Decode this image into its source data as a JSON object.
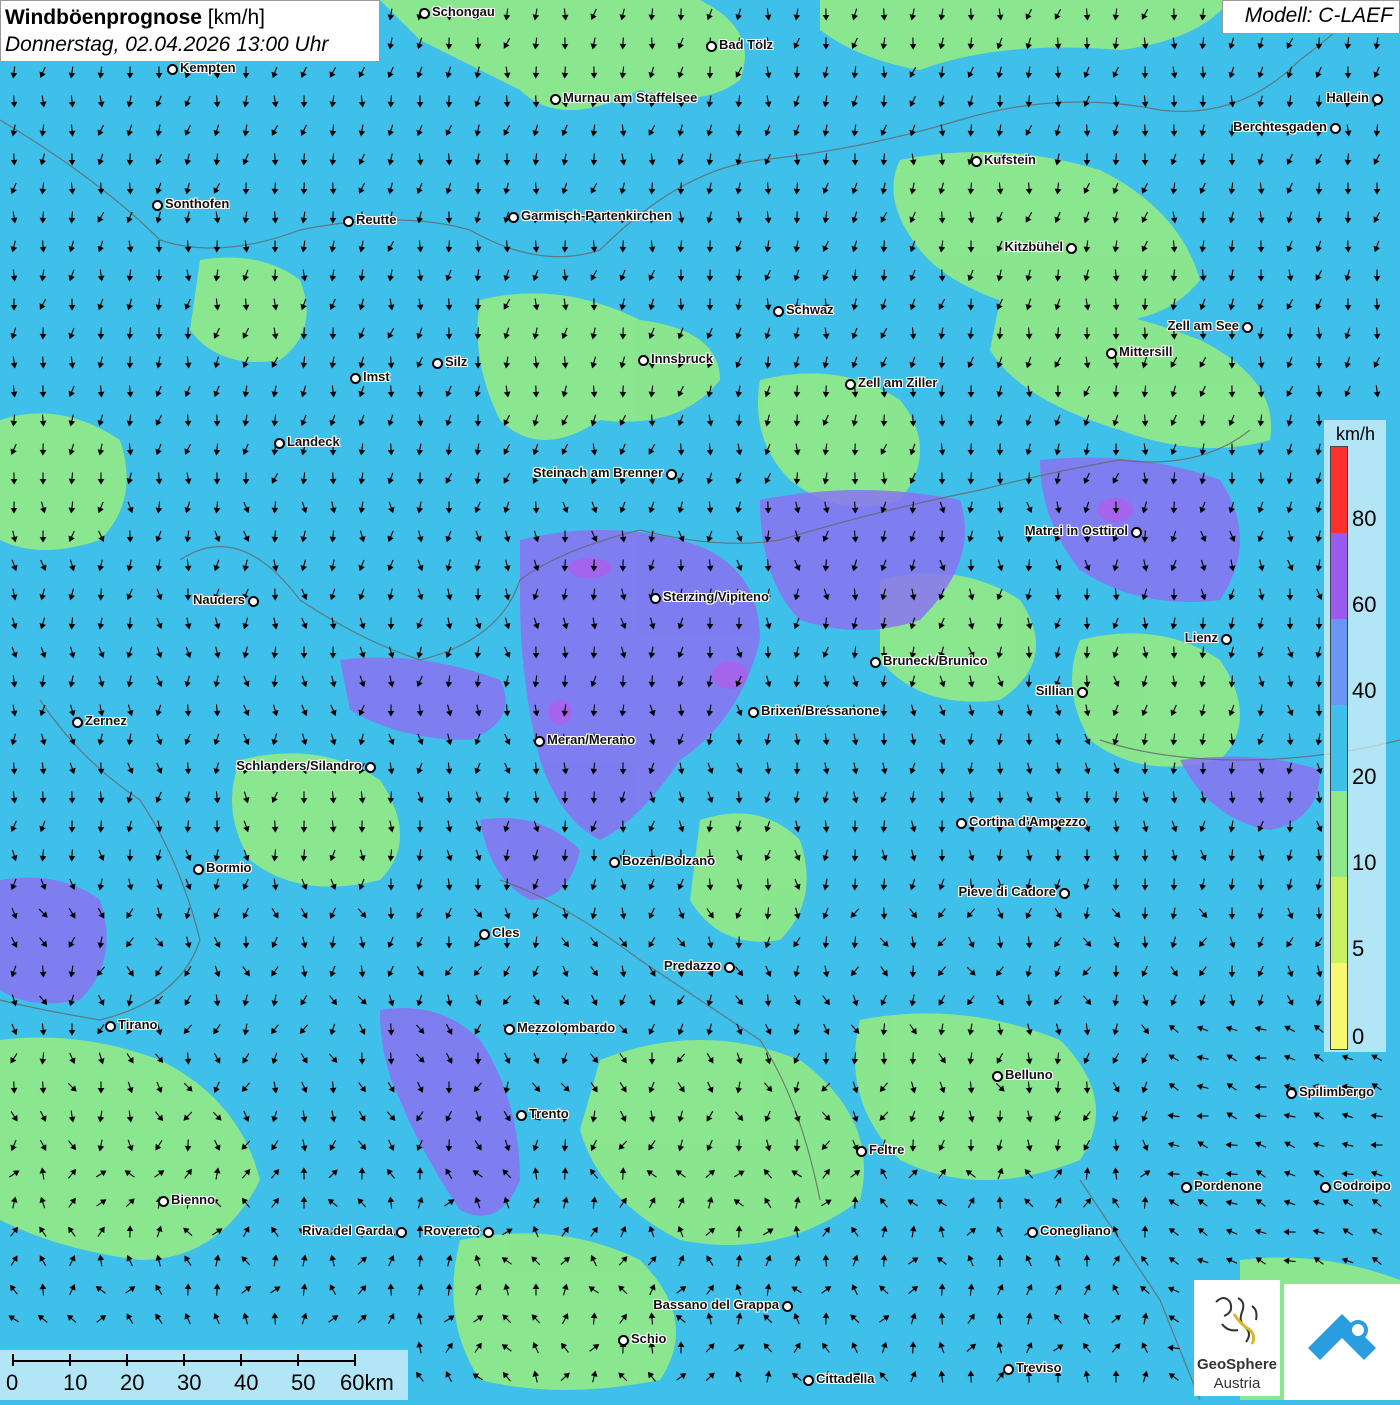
{
  "title": {
    "bold": "Windböenprognose",
    "unit": " [km/h]",
    "date": "Donnerstag, 02.04.2026 13:00 Uhr"
  },
  "model": "Modell: C-LAEF",
  "legend": {
    "unit": "km/h",
    "ticks": [
      "80",
      "60",
      "40",
      "20",
      "10",
      "5",
      "0"
    ],
    "colors": [
      "#ff3030",
      "#9a5cf0",
      "#6a96f6",
      "#3fc0ea",
      "#8ee88a",
      "#c8f060",
      "#f8f870"
    ]
  },
  "scalebar": {
    "labels": [
      "0",
      "10",
      "20",
      "30",
      "40",
      "50",
      "60km"
    ]
  },
  "logo": {
    "line1": "GeoSphere",
    "line2": "Austria"
  },
  "colors": {
    "background": "#3fc0ea",
    "light_green": "#8ee88a",
    "purple": "#9a5cf0",
    "blue": "#6a96f6"
  },
  "cities": [
    {
      "name": "Schongau",
      "side": "right"
    },
    {
      "name": "Bad Tölz",
      "side": "right"
    },
    {
      "name": "Kempten",
      "side": "right"
    },
    {
      "name": "Murnau am Staffelsee",
      "side": "right"
    },
    {
      "name": "Hallein",
      "side": "left"
    },
    {
      "name": "Berchtesgaden",
      "side": "left"
    },
    {
      "name": "Kufstein",
      "side": "right"
    },
    {
      "name": "Sonthofen",
      "side": "right"
    },
    {
      "name": "Reutte",
      "side": "right"
    },
    {
      "name": "Garmisch-Partenkirchen",
      "side": "right"
    },
    {
      "name": "Kitzbühel",
      "side": "left"
    },
    {
      "name": "Schwaz",
      "side": "right"
    },
    {
      "name": "Zell am See",
      "side": "left"
    },
    {
      "name": "Innsbruck",
      "side": "right"
    },
    {
      "name": "Mittersill",
      "side": "right"
    },
    {
      "name": "Imst",
      "side": "right"
    },
    {
      "name": "Silz",
      "side": "right"
    },
    {
      "name": "Zell am Ziller",
      "side": "right"
    },
    {
      "name": "Landeck",
      "side": "right"
    },
    {
      "name": "Steinach am Brenner",
      "side": "left"
    },
    {
      "name": "Matrei in Osttirol",
      "side": "left"
    },
    {
      "name": "Nauders",
      "side": "left"
    },
    {
      "name": "Sterzing/Vipiteno",
      "side": "right"
    },
    {
      "name": "Lienz",
      "side": "left"
    },
    {
      "name": "Bruneck/Brunico",
      "side": "right"
    },
    {
      "name": "Sillian",
      "side": "left"
    },
    {
      "name": "Zernez",
      "side": "right"
    },
    {
      "name": "Brixen/Bressanone",
      "side": "right"
    },
    {
      "name": "Meran/Merano",
      "side": "right"
    },
    {
      "name": "Schlanders/Silandro",
      "side": "left"
    },
    {
      "name": "Cortina d'Ampezzo",
      "side": "right"
    },
    {
      "name": "Bozen/Bolzano",
      "side": "right"
    },
    {
      "name": "Bormio",
      "side": "right"
    },
    {
      "name": "Pieve di Cadore",
      "side": "left"
    },
    {
      "name": "Cles",
      "side": "right"
    },
    {
      "name": "Predazzo",
      "side": "left"
    },
    {
      "name": "Tirano",
      "side": "right"
    },
    {
      "name": "Mezzolombardo",
      "side": "right"
    },
    {
      "name": "Belluno",
      "side": "right"
    },
    {
      "name": "Spilimbergo",
      "side": "right"
    },
    {
      "name": "Trento",
      "side": "right"
    },
    {
      "name": "Feltre",
      "side": "right"
    },
    {
      "name": "Pordenone",
      "side": "right"
    },
    {
      "name": "Codroipo",
      "side": "right"
    },
    {
      "name": "Bienno",
      "side": "right"
    },
    {
      "name": "Riva del Garda",
      "side": "left"
    },
    {
      "name": "Rovereto",
      "side": "left"
    },
    {
      "name": "Conegliano",
      "side": "right"
    },
    {
      "name": "Bassano del Grappa",
      "side": "left"
    },
    {
      "name": "Schio",
      "side": "right"
    },
    {
      "name": "Treviso",
      "side": "right"
    },
    {
      "name": "Cittadella",
      "side": "right"
    }
  ]
}
